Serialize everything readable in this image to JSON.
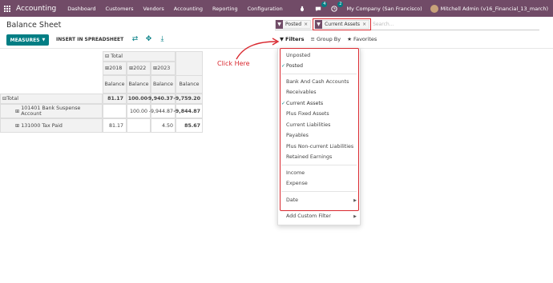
{
  "navbar": {
    "app_name": "Accounting",
    "menu": [
      "Dashboard",
      "Customers",
      "Vendors",
      "Accounting",
      "Reporting",
      "Configuration"
    ],
    "chat_badge": "4",
    "activity_badge": "2",
    "company": "My Company (San Francisco)",
    "user": "Mitchell Admin (v16_Financial_13_march)"
  },
  "page": {
    "title": "Balance Sheet",
    "measures_label": "MEASURES",
    "spreadsheet_label": "INSERT IN SPREADSHEET"
  },
  "search": {
    "facets": [
      "Posted",
      "Current Assets"
    ],
    "placeholder": "Search..."
  },
  "control_buttons": {
    "filters": "Filters",
    "group_by": "Group By",
    "favorites": "Favorites"
  },
  "pivot": {
    "col_total": "Total",
    "years": [
      "2018",
      "2022",
      "2023"
    ],
    "measure": "Balance",
    "rows": [
      {
        "label": "Total",
        "values": [
          "81.17",
          "100.00",
          "-9,940.37",
          "-9,759.20"
        ]
      },
      {
        "label": "101401 Bank Suspense Account",
        "values": [
          "",
          "100.00",
          "-9,944.87",
          "-9,844.87"
        ]
      },
      {
        "label": "131000 Tax Paid",
        "values": [
          "81.17",
          "",
          "4.50",
          "85.67"
        ]
      }
    ]
  },
  "filter_menu": {
    "items": [
      {
        "label": "Unposted",
        "checked": false
      },
      {
        "label": "Posted",
        "checked": true
      },
      {
        "label": "Bank And Cash Accounts",
        "checked": false
      },
      {
        "label": "Receivables",
        "checked": false
      },
      {
        "label": "Current Assets",
        "checked": true
      },
      {
        "label": "Plus Fixed Assets",
        "checked": false
      },
      {
        "label": "Current Liabilities",
        "checked": false
      },
      {
        "label": "Payables",
        "checked": false
      },
      {
        "label": "Plus Non-current Liabilities",
        "checked": false
      },
      {
        "label": "Retained Earnings",
        "checked": false
      },
      {
        "label": "Income",
        "checked": false
      },
      {
        "label": "Expense",
        "checked": false
      },
      {
        "label": "Date",
        "checked": false
      },
      {
        "label": "Add Custom Filter",
        "checked": false
      }
    ]
  },
  "annotation": {
    "text": "Click Here"
  },
  "colors": {
    "brand": "#714B67",
    "accent": "#017E84",
    "highlight": "#d9282f"
  }
}
